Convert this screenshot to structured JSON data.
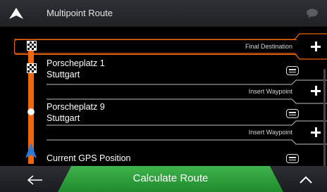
{
  "header": {
    "title": "Multipoint Route",
    "logo_icon": "nav-arrow-icon",
    "message_icon": "speech-bubble-icon"
  },
  "route": {
    "final_destination_label": "Final Destination",
    "waypoints": [
      {
        "line1": "Porscheplatz 1",
        "line2": "Stuttgart"
      },
      {
        "line1": "Porscheplatz 9",
        "line2": "Stuttgart"
      },
      {
        "line1": "Current GPS Position",
        "line2": ""
      }
    ],
    "insert_waypoint_label": "Insert Waypoint"
  },
  "footer": {
    "calculate_label": "Calculate Route"
  },
  "colors": {
    "accent_orange": "#f0660f",
    "green": "#2ea23c",
    "header_bg": "#2b2d32"
  }
}
